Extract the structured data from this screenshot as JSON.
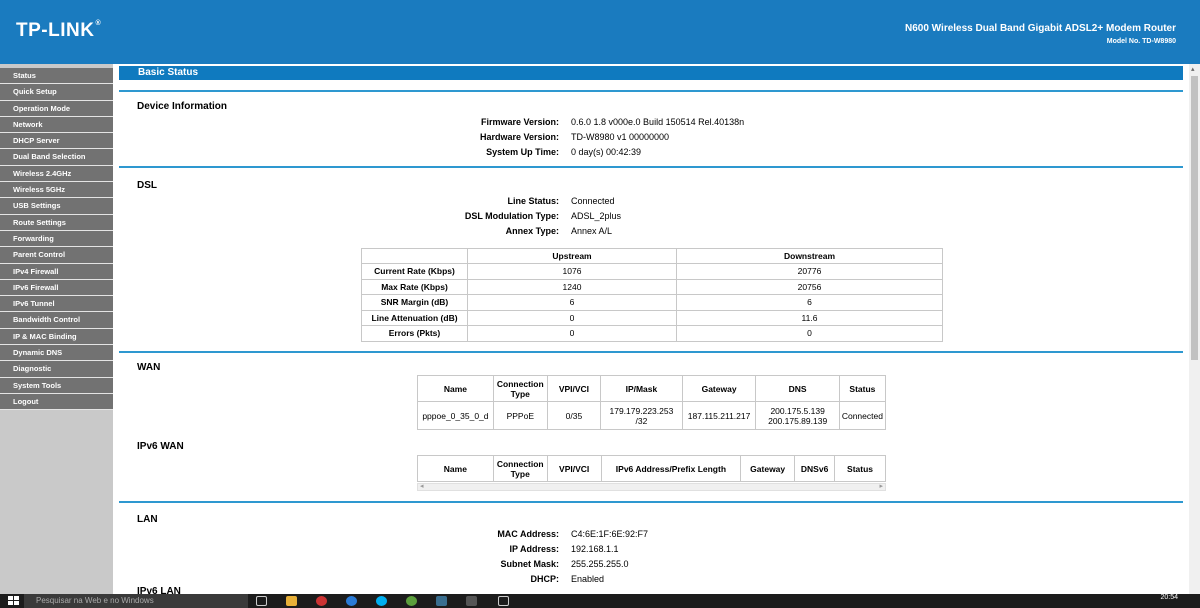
{
  "header": {
    "logo": "TP-LINK",
    "product": "N600 Wireless Dual Band Gigabit ADSL2+ Modem Router",
    "model": "Model No. TD-W8980"
  },
  "sidebar": {
    "items": [
      {
        "label": "Status"
      },
      {
        "label": "Quick Setup"
      },
      {
        "label": "Operation Mode"
      },
      {
        "label": "Network"
      },
      {
        "label": "DHCP Server"
      },
      {
        "label": "Dual Band Selection"
      },
      {
        "label": "Wireless 2.4GHz"
      },
      {
        "label": "Wireless 5GHz"
      },
      {
        "label": "USB Settings"
      },
      {
        "label": "Route Settings"
      },
      {
        "label": "Forwarding"
      },
      {
        "label": "Parent Control"
      },
      {
        "label": "IPv4 Firewall"
      },
      {
        "label": "IPv6 Firewall"
      },
      {
        "label": "IPv6 Tunnel"
      },
      {
        "label": "Bandwidth Control"
      },
      {
        "label": "IP & MAC Binding"
      },
      {
        "label": "Dynamic DNS"
      },
      {
        "label": "Diagnostic"
      },
      {
        "label": "System Tools"
      },
      {
        "label": "Logout"
      }
    ]
  },
  "main": {
    "title": "Basic Status",
    "device": {
      "heading": "Device Information",
      "rows": [
        {
          "k": "Firmware Version:",
          "v": "0.6.0 1.8 v000e.0 Build 150514 Rel.40138n"
        },
        {
          "k": "Hardware Version:",
          "v": "TD-W8980 v1 00000000"
        },
        {
          "k": "System Up Time:",
          "v": "0 day(s) 00:42:39"
        }
      ]
    },
    "dsl": {
      "heading": "DSL",
      "rows": [
        {
          "k": "Line Status:",
          "v": "Connected"
        },
        {
          "k": "DSL Modulation Type:",
          "v": "ADSL_2plus"
        },
        {
          "k": "Annex Type:",
          "v": "Annex A/L"
        }
      ],
      "table": {
        "headers": [
          "",
          "Upstream",
          "Downstream"
        ],
        "rows": [
          [
            "Current Rate (Kbps)",
            "1076",
            "20776"
          ],
          [
            "Max Rate (Kbps)",
            "1240",
            "20756"
          ],
          [
            "SNR Margin (dB)",
            "6",
            "6"
          ],
          [
            "Line Attenuation (dB)",
            "0",
            "11.6"
          ],
          [
            "Errors (Pkts)",
            "0",
            "0"
          ]
        ]
      }
    },
    "wan": {
      "heading": "WAN",
      "headers": [
        "Name",
        "Connection Type",
        "VPI/VCI",
        "IP/Mask",
        "Gateway",
        "DNS",
        "Status"
      ],
      "row": {
        "name": "pppoe_0_35_0_d",
        "type": "PPPoE",
        "vpi": "0/35",
        "ip1": "179.179.223.253",
        "ip2": "/32",
        "gateway": "187.115.211.217",
        "dns1": "200.175.5.139",
        "dns2": "200.175.89.139",
        "status": "Connected"
      }
    },
    "ipv6wan": {
      "heading": "IPv6 WAN",
      "headers": [
        "Name",
        "Connection Type",
        "VPI/VCI",
        "IPv6 Address/Prefix Length",
        "Gateway",
        "DNSv6",
        "Status"
      ]
    },
    "lan": {
      "heading": "LAN",
      "rows": [
        {
          "k": "MAC Address:",
          "v": "C4:6E:1F:6E:92:F7"
        },
        {
          "k": "IP Address:",
          "v": "192.168.1.1"
        },
        {
          "k": "Subnet Mask:",
          "v": "255.255.255.0"
        },
        {
          "k": "DHCP:",
          "v": "Enabled"
        }
      ]
    },
    "ipv6lan": {
      "heading": "IPv6 LAN"
    }
  },
  "taskbar": {
    "search_placeholder": "Pesquisar na Web e no Windows",
    "time": "20:54"
  },
  "colors": {
    "header": "#1a7bbf",
    "sidebar_item": "#727272",
    "title_bar": "#0f7abf"
  }
}
